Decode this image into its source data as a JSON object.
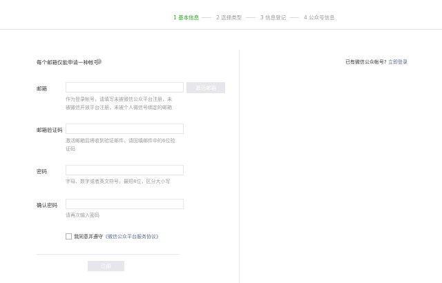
{
  "steps": [
    {
      "label": "1 基本信息",
      "active": true
    },
    {
      "label": "2 选择类型",
      "active": false
    },
    {
      "label": "3 信息登记",
      "active": false
    },
    {
      "label": "4 公众号信息",
      "active": false
    }
  ],
  "form": {
    "heading": "每个邮箱仅能申请一种帐号",
    "help_icon": "question-icon",
    "email": {
      "label": "邮箱",
      "value": "",
      "button": "激活邮箱",
      "hint_line1": "作为登录帐号，请填写未被微信公众平台注册，未",
      "hint_line2": "被微信开放平台注册，未被个人微信号绑定的邮箱"
    },
    "code": {
      "label": "邮箱验证码",
      "value": "",
      "hint_line1": "激活邮箱后将收到验证邮件，请回填邮件中的6位验",
      "hint_line2": "证码"
    },
    "password": {
      "label": "密码",
      "value": "",
      "hint": "字母、数字或者英文符号，最短8位，区分大小写"
    },
    "confirm": {
      "label": "确认密码",
      "value": "",
      "hint": "请再次输入密码"
    },
    "agreement": {
      "prefix": "我同意并遵守",
      "link": "《微信公众平台服务协议》",
      "checked": false
    },
    "register_button": "注册"
  },
  "aside": {
    "question": "已有微信公众帐号?",
    "login_link": "立即登录"
  },
  "colors": {
    "accent": "#1aad19",
    "link": "#576b95",
    "hint": "#9a9a9a",
    "border": "#e7e7eb",
    "button_disabled": "#e7e7eb"
  }
}
